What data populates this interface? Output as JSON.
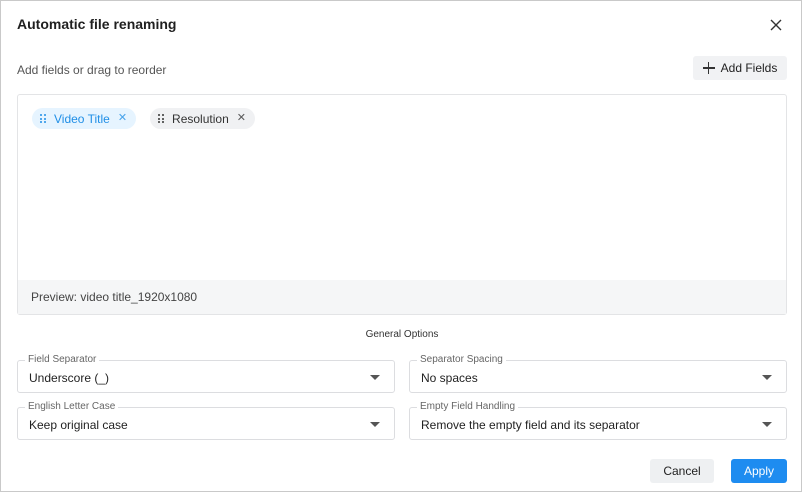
{
  "dialog": {
    "title": "Automatic file renaming",
    "hint": "Add fields or drag to reorder",
    "add_fields_label": "Add Fields"
  },
  "fields": [
    {
      "label": "Video Title",
      "state": "active"
    },
    {
      "label": "Resolution",
      "state": "normal"
    }
  ],
  "preview": "Preview: video title_1920x1080",
  "general_options": {
    "title": "General Options",
    "field_separator": {
      "label": "Field Separator",
      "value": "Underscore (_)"
    },
    "separator_spacing": {
      "label": "Separator Spacing",
      "value": "No spaces"
    },
    "letter_case": {
      "label": "English Letter Case",
      "value": "Keep original case"
    },
    "empty_field": {
      "label": "Empty Field Handling",
      "value": "Remove the empty field and its separator"
    }
  },
  "actions": {
    "cancel_label": "Cancel",
    "apply_label": "Apply"
  },
  "colors": {
    "accent": "#1e8cf0",
    "chip_active_bg": "#e6f4ff",
    "chip_active_text": "#1f8ee6"
  },
  "icons": {
    "close": "close-icon",
    "add": "plus-icon",
    "drag": "drag-handle-icon",
    "remove": "remove-chip-icon",
    "dropdown": "chevron-down-icon"
  }
}
